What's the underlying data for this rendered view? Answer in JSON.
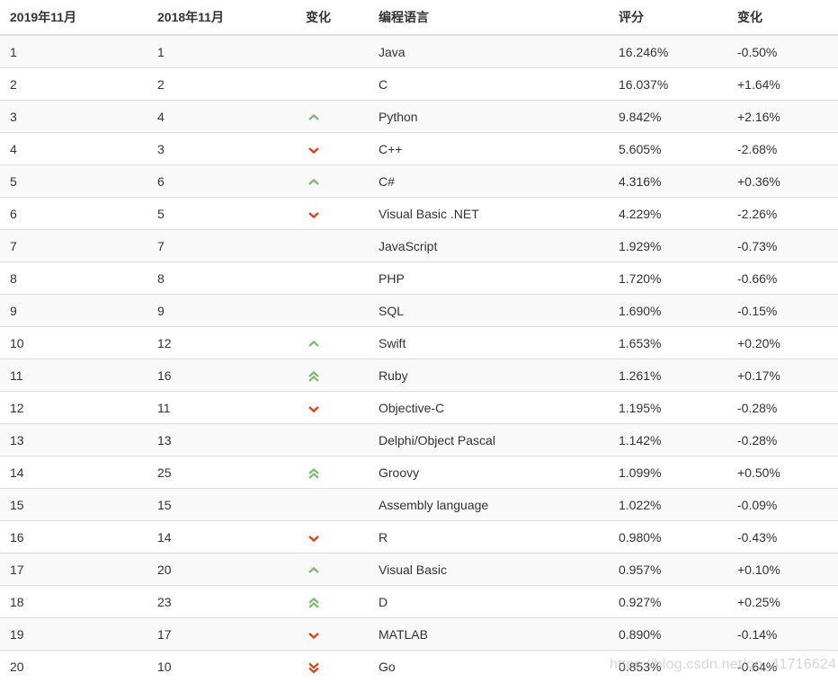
{
  "colors": {
    "up": "#7cbd6c",
    "down": "#e0430f",
    "stripe": "#f9f9f9",
    "border": "#dddddd"
  },
  "headers": [
    "2019年11月",
    "2018年11月",
    "变化",
    "编程语言",
    "评分",
    "变化"
  ],
  "rows": [
    {
      "rank2019": "1",
      "rank2018": "1",
      "trend": "none",
      "language": "Java",
      "rating": "16.246%",
      "change": "-0.50%"
    },
    {
      "rank2019": "2",
      "rank2018": "2",
      "trend": "none",
      "language": "C",
      "rating": "16.037%",
      "change": "+1.64%"
    },
    {
      "rank2019": "3",
      "rank2018": "4",
      "trend": "up",
      "language": "Python",
      "rating": "9.842%",
      "change": "+2.16%"
    },
    {
      "rank2019": "4",
      "rank2018": "3",
      "trend": "down",
      "language": "C++",
      "rating": "5.605%",
      "change": "-2.68%"
    },
    {
      "rank2019": "5",
      "rank2018": "6",
      "trend": "up",
      "language": "C#",
      "rating": "4.316%",
      "change": "+0.36%"
    },
    {
      "rank2019": "6",
      "rank2018": "5",
      "trend": "down",
      "language": "Visual Basic .NET",
      "rating": "4.229%",
      "change": "-2.26%"
    },
    {
      "rank2019": "7",
      "rank2018": "7",
      "trend": "none",
      "language": "JavaScript",
      "rating": "1.929%",
      "change": "-0.73%"
    },
    {
      "rank2019": "8",
      "rank2018": "8",
      "trend": "none",
      "language": "PHP",
      "rating": "1.720%",
      "change": "-0.66%"
    },
    {
      "rank2019": "9",
      "rank2018": "9",
      "trend": "none",
      "language": "SQL",
      "rating": "1.690%",
      "change": "-0.15%"
    },
    {
      "rank2019": "10",
      "rank2018": "12",
      "trend": "up",
      "language": "Swift",
      "rating": "1.653%",
      "change": "+0.20%"
    },
    {
      "rank2019": "11",
      "rank2018": "16",
      "trend": "up2",
      "language": "Ruby",
      "rating": "1.261%",
      "change": "+0.17%"
    },
    {
      "rank2019": "12",
      "rank2018": "11",
      "trend": "down",
      "language": "Objective-C",
      "rating": "1.195%",
      "change": "-0.28%"
    },
    {
      "rank2019": "13",
      "rank2018": "13",
      "trend": "none",
      "language": "Delphi/Object Pascal",
      "rating": "1.142%",
      "change": "-0.28%"
    },
    {
      "rank2019": "14",
      "rank2018": "25",
      "trend": "up2",
      "language": "Groovy",
      "rating": "1.099%",
      "change": "+0.50%"
    },
    {
      "rank2019": "15",
      "rank2018": "15",
      "trend": "none",
      "language": "Assembly language",
      "rating": "1.022%",
      "change": "-0.09%"
    },
    {
      "rank2019": "16",
      "rank2018": "14",
      "trend": "down",
      "language": "R",
      "rating": "0.980%",
      "change": "-0.43%"
    },
    {
      "rank2019": "17",
      "rank2018": "20",
      "trend": "up",
      "language": "Visual Basic",
      "rating": "0.957%",
      "change": "+0.10%"
    },
    {
      "rank2019": "18",
      "rank2018": "23",
      "trend": "up2",
      "language": "D",
      "rating": "0.927%",
      "change": "+0.25%"
    },
    {
      "rank2019": "19",
      "rank2018": "17",
      "trend": "down",
      "language": "MATLAB",
      "rating": "0.890%",
      "change": "-0.14%"
    },
    {
      "rank2019": "20",
      "rank2018": "10",
      "trend": "down2",
      "language": "Go",
      "rating": "0.853%",
      "change": "-0.64%"
    }
  ],
  "watermark": "https://blog.csdn.net/qq_41716624"
}
